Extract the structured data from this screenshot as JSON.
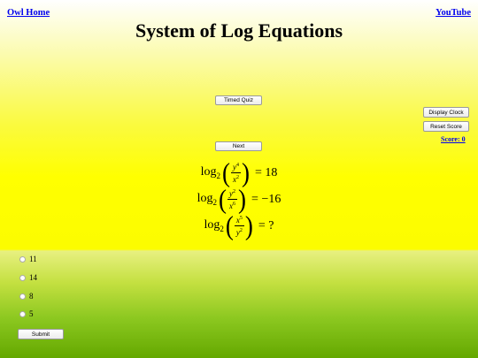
{
  "nav": {
    "home_label": "Owl Home",
    "youtube_label": "YouTube"
  },
  "title": "System of Log Equations",
  "buttons": {
    "timed_quiz": "Timed Quiz",
    "next": "Next",
    "display_clock": "Display Clock",
    "reset_score": "Reset Score",
    "submit": "Submit"
  },
  "score_label": "Score: 0",
  "equations": [
    {
      "log": "log",
      "base": "2",
      "num_var": "y",
      "num_exp": "4",
      "den_var": "x",
      "den_exp": "2",
      "rhs": "= 18"
    },
    {
      "log": "log",
      "base": "2",
      "num_var": "y",
      "num_exp": "2",
      "den_var": "x",
      "den_exp": "6",
      "rhs": "= −16"
    },
    {
      "log": "log",
      "base": "2",
      "num_var": "x",
      "num_exp": "5",
      "den_var": "y",
      "den_exp": "2",
      "rhs": "= ?"
    }
  ],
  "options": [
    "11",
    "14",
    "8",
    "5"
  ],
  "colors": {
    "link": "#0000ee",
    "top_bg": "#ffff00",
    "bottom_bg": "#64a800"
  }
}
